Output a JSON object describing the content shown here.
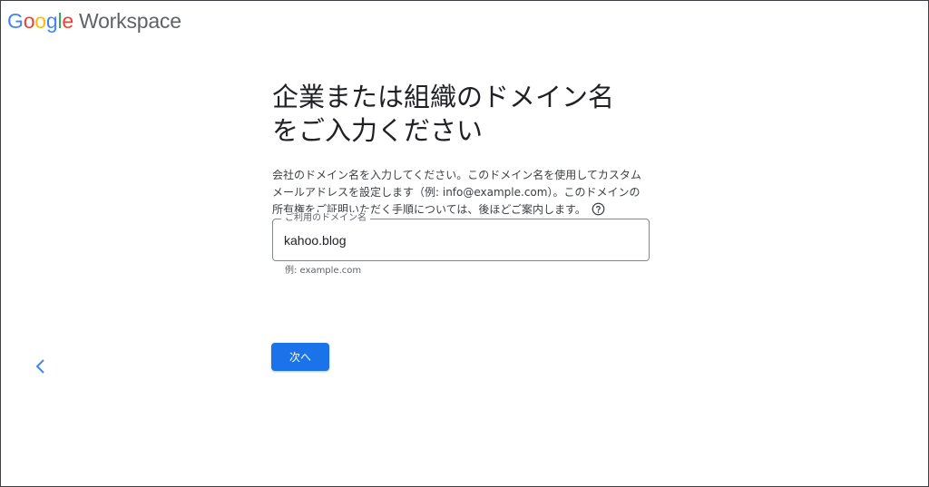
{
  "header": {
    "logo_letters": [
      {
        "ch": "G",
        "color": "#4285F4"
      },
      {
        "ch": "o",
        "color": "#EA4335"
      },
      {
        "ch": "o",
        "color": "#FBBC05"
      },
      {
        "ch": "g",
        "color": "#4285F4"
      },
      {
        "ch": "l",
        "color": "#34A853"
      },
      {
        "ch": "e",
        "color": "#EA4335"
      }
    ],
    "product": "Workspace"
  },
  "main": {
    "title": "企業または組織のドメイン名をご入力ください",
    "description": "会社のドメイン名を入力してください。このドメイン名を使用してカスタムメールアドレスを設定します（例: info@example.com）。このドメインの所有権をご証明いただく手順については、後ほどご案内します。",
    "help_icon": "help-circle-icon"
  },
  "domain_field": {
    "label": "ご利用のドメイン名",
    "value": "kahoo.blog",
    "hint": "例: example.com"
  },
  "actions": {
    "next_label": "次へ",
    "back_icon": "chevron-left-icon"
  },
  "colors": {
    "accent": "#1a73e8",
    "text_primary": "#202124",
    "text_secondary": "#5f6368"
  }
}
